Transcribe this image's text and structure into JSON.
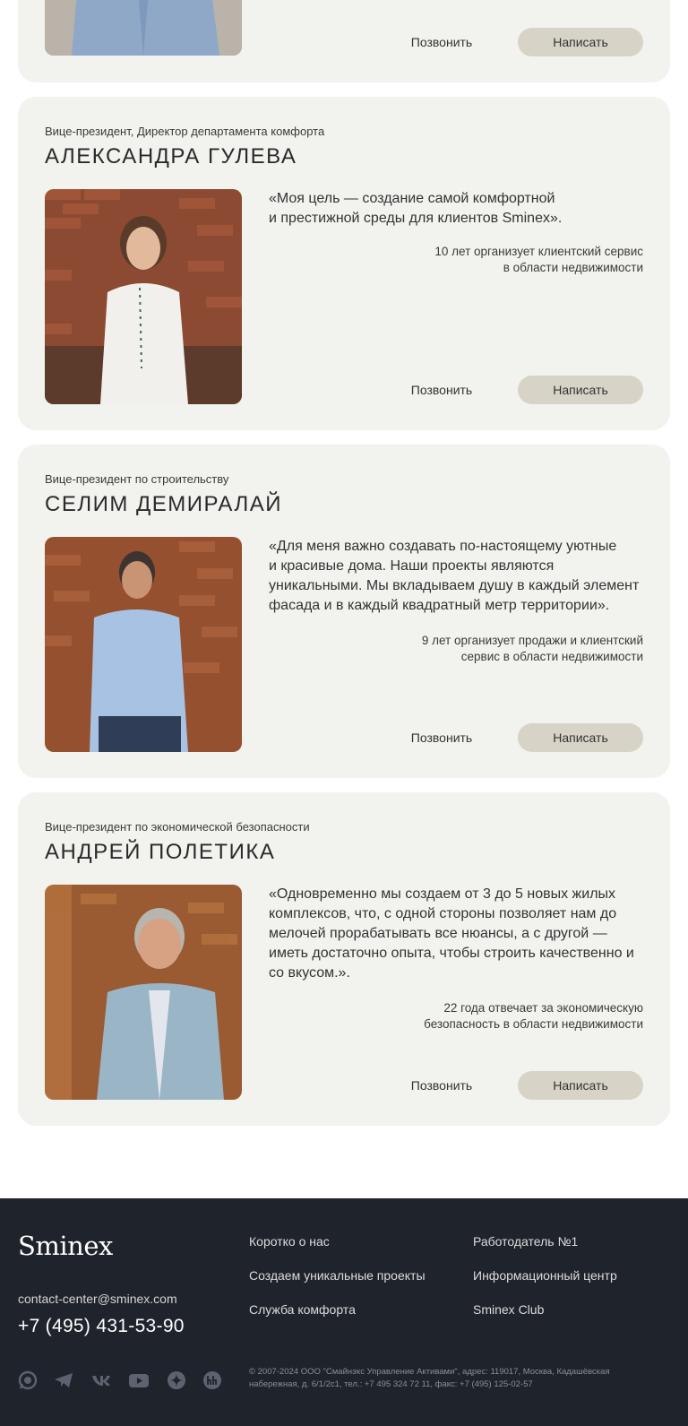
{
  "cards": [
    {
      "call_label": "Позвонить",
      "write_label": "Написать"
    },
    {
      "position": "Вице-президент, Директор департамента комфорта",
      "name": "АЛЕКСАНДРА ГУЛЕВА",
      "quote_lines": [
        "«Моя цель — создание самой комфортной",
        "и престижной среды для клиентов Sminex»."
      ],
      "experience_lines": [
        "10 лет организует клиентский сервис",
        "в области недвижимости"
      ],
      "call_label": "Позвонить",
      "write_label": "Написать"
    },
    {
      "position": "Вице-президент по строительству",
      "name": "СЕЛИМ ДЕМИРАЛАЙ",
      "quote_lines": [
        "«Для меня важно создавать по-настоящему уютные",
        "и красивые дома. Наши проекты являются",
        "уникальными. Мы вкладываем душу в каждый элемент",
        "фасада и в каждый квадратный метр территории»."
      ],
      "experience_lines": [
        "9 лет организует продажи и клиентский",
        "сервис в области недвижимости"
      ],
      "call_label": "Позвонить",
      "write_label": "Написать"
    },
    {
      "position": "Вице-президент по экономической безопасности",
      "name": "АНДРЕЙ ПОЛЕТИКА",
      "quote_lines": [
        "«Одновременно мы создаем от 3 до 5 новых жилых",
        "комплексов, что, с одной стороны позволяет нам до",
        "мелочей прорабатывать все нюансы, а с другой —",
        "иметь достаточно опыта, чтобы строить качественно и",
        "со вкусом.»."
      ],
      "experience_lines": [
        "22 года отвечает за экономическую",
        "безопасность в области недвижимости"
      ],
      "call_label": "Позвонить",
      "write_label": "Написать"
    }
  ],
  "footer": {
    "logo": "Sminex",
    "email": "contact-center@sminex.com",
    "phone": "+7 (495) 431-53-90",
    "links_col1": [
      "Коротко о нас",
      "Создаем уникальные проекты",
      "Служба комфорта"
    ],
    "links_col2": [
      "Работодатель №1",
      "Информационный центр",
      "Sminex Club"
    ],
    "socials": [
      "whatsapp-icon",
      "telegram-icon",
      "vk-icon",
      "youtube-icon",
      "zen-icon",
      "headhunter-icon"
    ],
    "copyright_lines": [
      "© 2007-2024 ООО \"Смайнэкс Управление Активами\", адрес: 119017, Москва, Кадашёвская",
      "набережная, д. 6/1/2с1, тел.: +7 495 324 72 11, факс: +7 (495) 125-02-57"
    ]
  },
  "colors": {
    "card_bg": "#f2f2ee",
    "button_bg": "#d7d3c6",
    "footer_bg": "#1f232b"
  }
}
